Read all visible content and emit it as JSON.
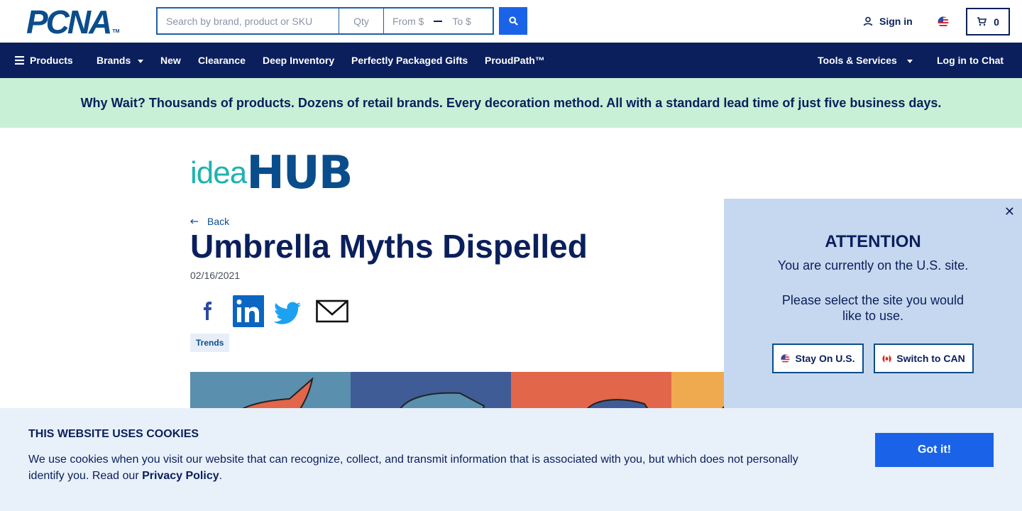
{
  "header": {
    "logo": "PCNA",
    "logo_tm": "TM",
    "search": {
      "placeholder": "Search by brand, product or SKU",
      "qty_placeholder": "Qty",
      "from_placeholder": "From $",
      "to_placeholder": "To $"
    },
    "signin_label": "Sign in",
    "cart_count": "0"
  },
  "nav": {
    "items": [
      {
        "label": "Products"
      },
      {
        "label": "Brands"
      },
      {
        "label": "New"
      },
      {
        "label": "Clearance"
      },
      {
        "label": "Deep Inventory"
      },
      {
        "label": "Perfectly Packaged Gifts"
      },
      {
        "label": "ProudPath™"
      }
    ],
    "tools_label": "Tools & Services",
    "chat_label": "Log in to Chat"
  },
  "promo": "Why Wait? Thousands of products. Dozens of retail brands. Every decoration method. All with a standard lead time of just five business days.",
  "article": {
    "brand_idea": "idea",
    "brand_hub": "HUB",
    "back_label": "Back",
    "title": "Umbrella Myths Dispelled",
    "date": "02/16/2021",
    "tag": "Trends"
  },
  "popup": {
    "title": "ATTENTION",
    "message1": "You are currently on the U.S. site.",
    "message2": "Please select the site you would like to use.",
    "stay_label": "Stay On U.S.",
    "switch_label": "Switch to CAN"
  },
  "cookies": {
    "title": "THIS WEBSITE USES COOKIES",
    "text": "We use cookies when you visit our website that can recognize, collect, and transmit information that is associated with you, but which does not personally identify you. Read our ",
    "link": "Privacy Policy",
    "suffix": ".",
    "button": "Got it!"
  },
  "colors": {
    "navy": "#0a1f5c",
    "brand_blue": "#1a63e8",
    "promo_green": "#c8f0d6",
    "popup_bg": "#c6d8ef",
    "cookie_bg": "#e8f0fa"
  }
}
